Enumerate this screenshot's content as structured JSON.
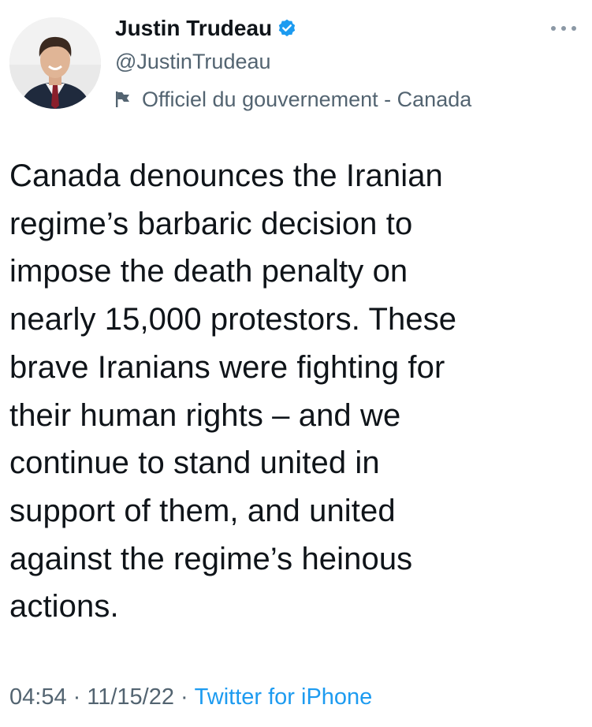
{
  "author": {
    "display_name": "Justin Trudeau",
    "handle": "@JustinTrudeau",
    "verified": true,
    "verified_icon": "verified-badge-icon",
    "account_label_icon": "flag-icon",
    "account_label": "Officiel du gouvernement - Canada"
  },
  "more_icon": "more-horizontal-icon",
  "tweet": {
    "lines": [
      "Canada denounces the Iranian",
      "regime’s barbaric decision to",
      "impose the death penalty on",
      "nearly 15,000 protestors. These",
      "brave Iranians were fighting for",
      "their human rights – and we",
      "continue to stand united in",
      "support of them, and united",
      "against the regime’s heinous",
      "actions."
    ]
  },
  "meta": {
    "time": "04:54",
    "separator": "·",
    "date": "11/15/22",
    "source": "Twitter for iPhone"
  },
  "colors": {
    "text": "#0f1419",
    "secondary_text": "#536471",
    "accent": "#1d9bf0"
  }
}
